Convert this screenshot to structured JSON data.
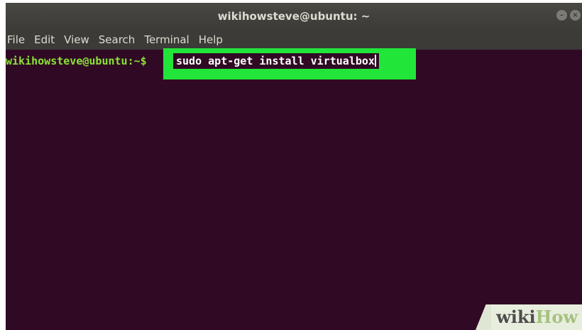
{
  "window": {
    "title": "wikihowsteve@ubuntu: ~",
    "buttons": [
      "–",
      "×"
    ]
  },
  "menubar": {
    "items": [
      "File",
      "Edit",
      "View",
      "Search",
      "Terminal",
      "Help"
    ]
  },
  "terminal": {
    "prompt": "wikihowsteve@ubuntu:~$",
    "command": "sudo apt-get install virtualbox"
  },
  "watermark": {
    "part1": "wiki",
    "part2": "How"
  },
  "colors": {
    "terminal_bg": "#300a24",
    "prompt": "#8ae234",
    "highlight": "#22e53a",
    "titlebar": "#3c3b37"
  }
}
